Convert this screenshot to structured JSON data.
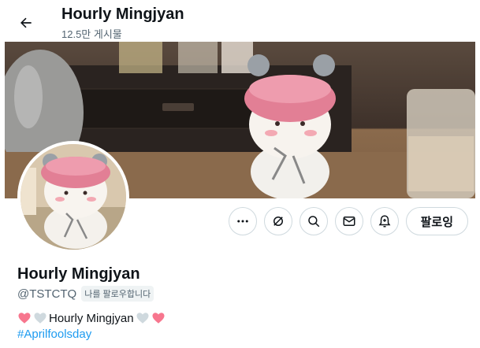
{
  "header": {
    "title": "Hourly Mingjyan",
    "posts_count": "12.5만 게시물"
  },
  "profile": {
    "name": "Hourly Mingjyan",
    "handle": "@TSTCTQ",
    "follows_you_badge": "나를 팔로우합니다",
    "bio_text": "Hourly Mingjyan",
    "hashtag": "#Aprilfoolsday"
  },
  "actions": {
    "more": "more-icon",
    "grok": "grok-icon",
    "search": "search-icon",
    "message": "envelope-icon",
    "notify": "bell-plus-icon",
    "follow_label": "팔로잉"
  },
  "colors": {
    "accent": "#1d9bf0",
    "pink_heart": "#f7768e",
    "white_heart": "#cfd9de"
  }
}
